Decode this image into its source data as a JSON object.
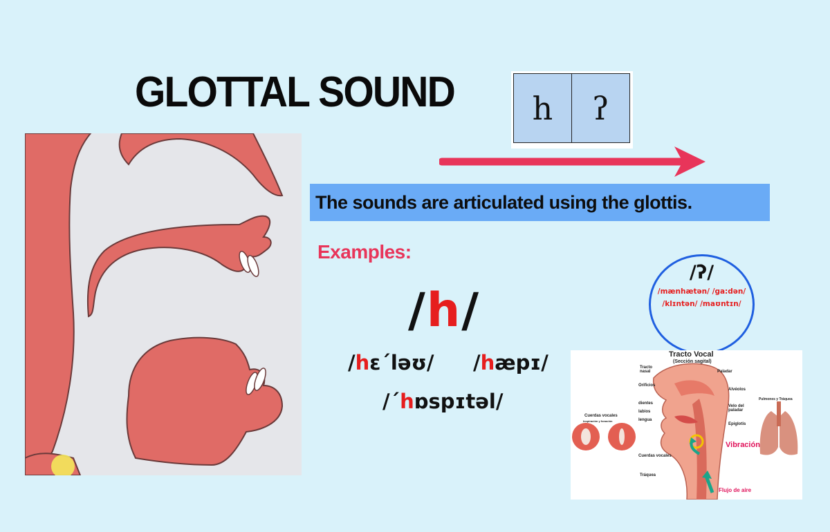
{
  "title": "GLOTTAL SOUND",
  "ipa_chart": {
    "cells": [
      "h",
      "ʔ"
    ]
  },
  "banner": {
    "text": "The sounds are articulated using the glottis."
  },
  "examples": {
    "label": "Examples:",
    "h": {
      "open": "/",
      "symbol": "h",
      "close": "/",
      "words": [
        {
          "pre": "/",
          "red": "h",
          "post": "ɛˊləʊ/"
        },
        {
          "pre": "/",
          "red": "h",
          "post": "æpɪ/"
        },
        {
          "pre": "/ˊ",
          "red": "h",
          "post": "ɒspɪtəl/"
        }
      ]
    },
    "glottal_stop": {
      "head": "/ʔ/",
      "line1": "/mænhætən/  /ga:dən/",
      "line2": "/klɪntən/ /maʊntɪn/"
    }
  },
  "vocal_tract": {
    "title": "Tracto Vocal",
    "subtitle": "(Sección sagital)",
    "labels": {
      "nasal": "Tracto nasal",
      "orificios": "Orificios",
      "dientes": "dientes",
      "labios": "labios",
      "lengua": "lengua",
      "paladar": "Paladar",
      "alveolos": "Alvéolos",
      "velo": "Velo del paladar",
      "epiglotis": "Epiglotis",
      "cuerdas_left": "Cuerdas vocales",
      "cuerdas_left_sub": "Inspiración y fonación",
      "cuerdas": "Cuerdas vocales",
      "traquea": "Tráquea",
      "vibracion": "Vibración",
      "flujo": "Flujo de aire",
      "pulmones": "Pulmones y Tráquea"
    }
  },
  "colors": {
    "accent_red": "#e8355a",
    "banner_blue": "#6aabf6",
    "tissue": "#e06b66",
    "background": "#d9f2fa"
  },
  "icons": [
    "arrow-right-icon",
    "sagittal-section-illustration",
    "vocal-tract-illustration"
  ]
}
